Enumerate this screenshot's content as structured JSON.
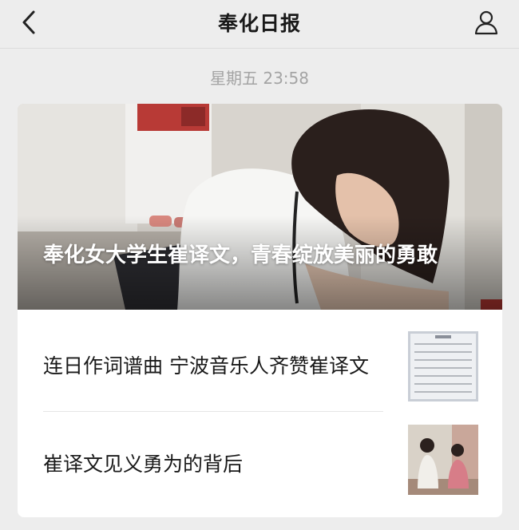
{
  "navbar": {
    "title": "奉化日报",
    "back_icon": "chevron-left-icon",
    "profile_icon": "user-icon"
  },
  "timestamp": "星期五 23:58",
  "card": {
    "featured": {
      "title": "奉化女大学生崔译文，青春绽放美丽的勇敢"
    },
    "articles": [
      {
        "title": "连日作词谱曲 宁波音乐人齐赞崔译文",
        "thumb": "sheet-music-thumbnail"
      },
      {
        "title": "崔译文见义勇为的背后",
        "thumb": "interview-photo-thumbnail"
      }
    ]
  },
  "colors": {
    "background": "#ededed",
    "card": "#ffffff",
    "text": "#191919",
    "muted": "#a4a4a4"
  }
}
